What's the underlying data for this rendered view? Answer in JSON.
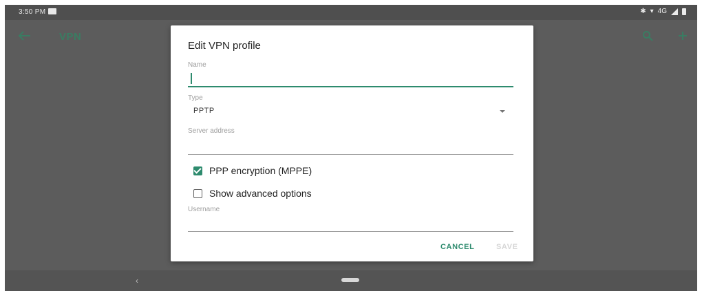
{
  "status": {
    "time": "3:50 PM",
    "network": "4G"
  },
  "appbar": {
    "title": "VPN"
  },
  "dialog": {
    "title": "Edit VPN profile",
    "name": {
      "label": "Name",
      "value": ""
    },
    "type": {
      "label": "Type",
      "value": "PPTP"
    },
    "server": {
      "label": "Server address",
      "value": ""
    },
    "ppp_encryption": {
      "label": "PPP encryption (MPPE)",
      "checked": true
    },
    "advanced": {
      "label": "Show advanced options",
      "checked": false
    },
    "username": {
      "label": "Username",
      "value": ""
    },
    "cancel_label": "CANCEL",
    "save_label": "SAVE"
  },
  "colors": {
    "accent": "#2e8b6e",
    "scrim": "#5c5c5c"
  },
  "icons": [
    "back-arrow-icon",
    "search-icon",
    "add-icon",
    "checkbox-checked-icon",
    "checkbox-unchecked-icon",
    "dropdown-arrow-icon"
  ]
}
